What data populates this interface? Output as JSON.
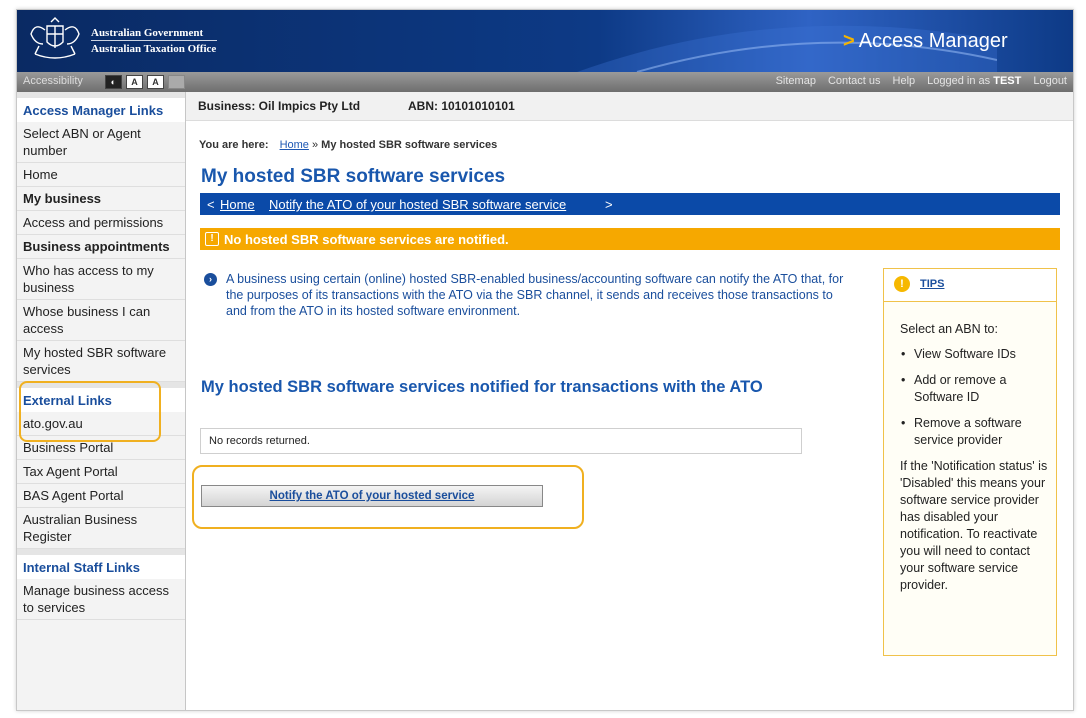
{
  "header": {
    "gov_line1": "Australian Government",
    "gov_line2": "Australian Taxation Office",
    "app_title": "Access Manager"
  },
  "utility": {
    "accessibility": "Accessibility",
    "access_icons": [
      "◐",
      "A",
      "A",
      ""
    ],
    "links": [
      "Sitemap",
      "Contact us",
      "Help",
      "Logged in as",
      "TEST",
      "Logout"
    ]
  },
  "sidebar": {
    "access_heading": "Access Manager Links",
    "access_items": [
      "Select ABN or Agent number",
      "Home",
      "My business",
      "Access and permissions",
      "Business appointments",
      "Who has access to my business",
      "Whose business I can access",
      "My hosted SBR software services"
    ],
    "external_heading": "External Links",
    "external_items": [
      "ato.gov.au",
      "Business Portal",
      "Tax Agent Portal",
      "BAS Agent Portal",
      "Australian Business Register"
    ],
    "internal_heading": "Internal Staff Links",
    "internal_items": [
      "Manage business access to services"
    ]
  },
  "business": {
    "name": "Business: Oil Impics Pty Ltd",
    "abn": "ABN: 10101010101"
  },
  "breadcrumb": {
    "label": "You are here:",
    "home": "Home",
    "separator": "»",
    "current": "My hosted SBR software services"
  },
  "page": {
    "title": "My hosted SBR software services",
    "nav_home": "Home",
    "nav_notify": "Notify the ATO of your hosted SBR software service",
    "alert": "No hosted SBR software services are notified.",
    "info": "A business using certain (online) hosted SBR-enabled business/accounting software can notify the ATO that, for the purposes of its transactions with the ATO via the SBR channel, it sends and receives those transactions to and from the ATO in its hosted software environment.",
    "section_title": "My hosted SBR software services notified for transactions with the ATO",
    "no_records": "No records returned.",
    "notify_button": "Notify the ATO of your hosted service"
  },
  "tips": {
    "label": "TIPS",
    "intro": "Select an ABN to:",
    "items": [
      "View Software IDs",
      "Add or remove a Software ID",
      "Remove a software service provider"
    ],
    "note": "If the 'Notification status' is 'Disabled' this means your software service provider has disabled your notification. To reactivate you will need to contact your software service provider."
  },
  "colors": {
    "brand_blue": "#1957ad",
    "nav_blue": "#0b4aa8",
    "alert_orange": "#f6a800",
    "highlight": "#f0b020"
  }
}
